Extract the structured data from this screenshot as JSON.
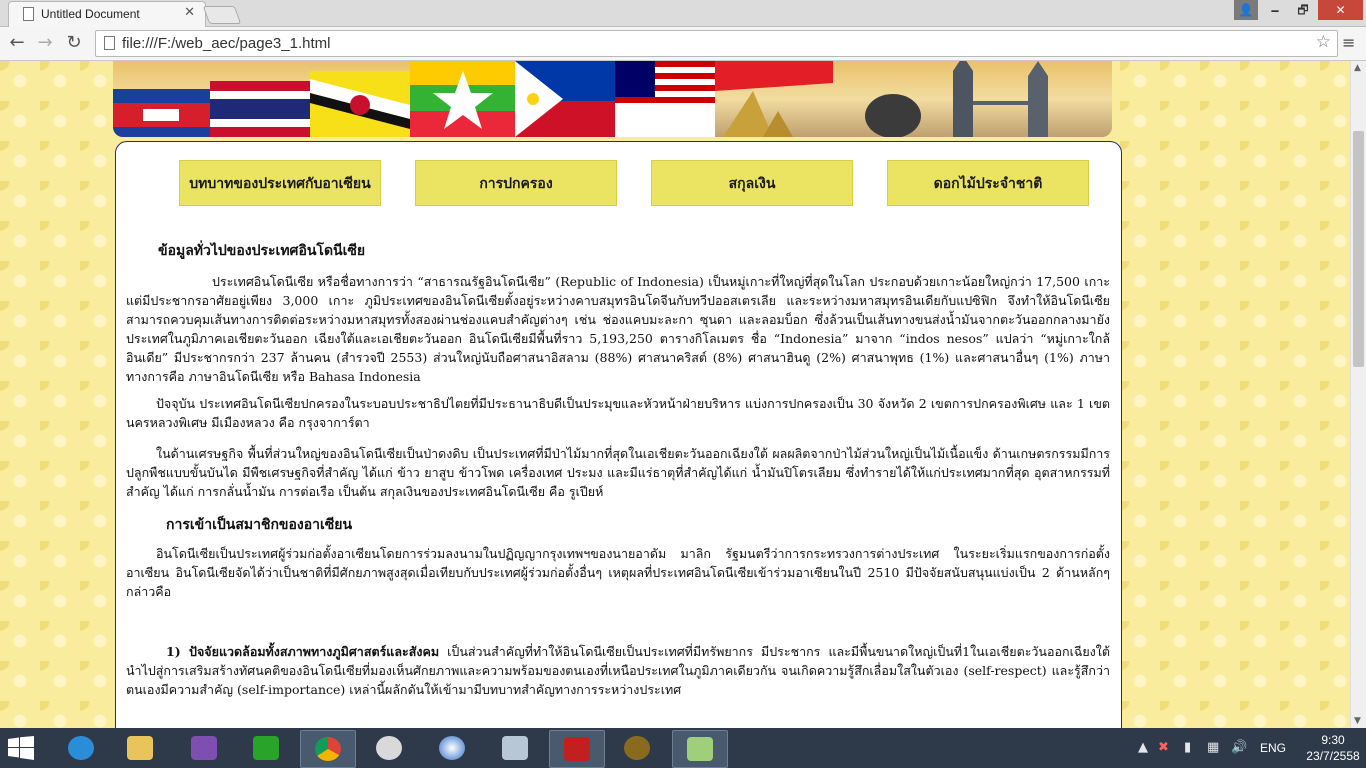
{
  "tab": {
    "title": "Untitled Document",
    "close": "✕"
  },
  "window": {
    "minimize": "🗕",
    "maximize": "🗗",
    "close": "✕",
    "user": "👤"
  },
  "toolbar": {
    "back": "←",
    "forward": "→",
    "reload": "↻",
    "star": "☆",
    "menu": "≡"
  },
  "address": {
    "url": "file:///F:/web_aec/page3_1.html"
  },
  "nav": {
    "buttons": [
      "บทบาทของประเทศกับอาเซียน",
      "การปกครอง",
      "สกุลเงิน",
      "ดอกไม้ประจำชาติ"
    ]
  },
  "content": {
    "heading1": "ข้อมูลทั่วไปของประเทศอินโดนีเซีย",
    "para1": "ประเทศอินโดนีเซีย หรือชื่อทางการว่า “สาธารณรัฐอินโดนีเซีย” (Republic of Indonesia) เป็นหมู่เกาะที่ใหญ่ที่สุดในโลก ประกอบด้วยเกาะน้อยใหญ่กว่า 17,500 เกาะ แต่มีประชากรอาศัยอยู่เพียง 3,000 เกาะ ภูมิประเทศของอินโดนีเซียตั้งอยู่ระหว่างคาบสมุทรอินโดจีนกับทวีปออสเตรเลีย และระหว่างมหาสมุทรอินเดียกับแปซิฟิก จึงทำให้อินโดนีเซียสามารถควบคุมเส้นทางการติดต่อระหว่างมหาสมุทรทั้งสองผ่านช่องแคบสำคัญต่างๆ เช่น ช่องแคบมะละกา ซุนดา และลอมบ็อก ซึ่งล้วนเป็นเส้นทางขนส่งน้ำมันจากตะวันออกกลางมายังประเทศในภูมิภาคเอเชียตะวันออก เฉียงใต้และเอเชียตะวันออก อินโดนีเซียมีพื้นที่ราว 5,193,250 ตารางกิโลเมตร ชื่อ “Indonesia” มาจาก “indos nesos” แปลว่า “หมู่เกาะใกล้อินเดีย” มีประชากรกว่า 237 ล้านคน (สำรวจปี 2553) ส่วนใหญ่นับถือศาสนาอิสลาม (88%) ศาสนาคริสต์ (8%) ศาสนาฮินดู (2%) ศาสนาพุทธ (1%) และศาสนาอื่นๆ (1%) ภาษาทางการคือ ภาษาอินโดนีเซีย หรือ Bahasa Indonesia",
    "para2": "ปัจจุบัน ประเทศอินโดนีเซียปกครองในระบอบประชาธิปไตยที่มีประธานาธิบดีเป็นประมุขและหัวหน้าฝ่ายบริหาร แบ่งการปกครองเป็น 30 จังหวัด 2 เขตการปกครองพิเศษ และ 1 เขตนครหลวงพิเศษ มีเมืองหลวง คือ กรุงจาการ์ตา",
    "para3": "ในด้านเศรษฐกิจ พื้นที่ส่วนใหญ่ของอินโดนีเซียเป็นป่าดงดิบ เป็นประเทศที่มีป่าไม้มากที่สุดในเอเชียตะวันออกเฉียงใต้ ผลผลิตจากป่าไม้ส่วนใหญ่เป็นไม้เนื้อแข็ง ด้านเกษตรกรรมมีการปลูกพืชแบบขั้นบันได มีพืชเศรษฐกิจที่สำคัญ ได้แก่ ข้าว ยาสูบ ข้าวโพด เครื่องเทศ ประมง และมีแร่ธาตุที่สำคัญได้แก่ น้ำมันปิโตรเลียม ซึ่งทำรายได้ให้แก่ประเทศมากที่สุด อุตสาหกรรมที่สำคัญ ได้แก่ การกลั่นน้ำมัน การต่อเรือ เป็นต้น สกุลเงินของประเทศอินโดนีเซีย คือ รูเปียห์",
    "heading2": "การเข้าเป็นสมาชิกของอาเซียน",
    "para4": "อินโดนีเซียเป็นประเทศผู้ร่วมก่อตั้งอาเซียนโดยการร่วมลงนามในปฏิญญากรุงเทพฯของนายอาดัม มาลิก รัฐมนตรีว่าการกระทรวงการต่างประเทศ ในระยะเริ่มแรกของการก่อตั้งอาเซียน อินโดนีเซียจัดได้ว่าเป็นชาติที่มีศักยภาพสูงสุดเมื่อเทียบกับประเทศผู้ร่วมก่อตั้งอื่นๆ เหตุผลที่ประเทศอินโดนีเซียเข้าร่วมอาเซียนในปี 2510 มีปัจจัยสนับสนุนแบ่งเป็น 2 ด้านหลักๆ กล่าวคือ",
    "para5_lead": "1) ปัจจัยแวดล้อมทั้งสภาพทางภูมิศาสตร์และสังคม",
    "para5_rest": " เป็นส่วนสำคัญที่ทำให้อินโดนีเซียเป็นประเทศที่มีทรัพยากร มีประชากร และมีพื้นขนาดใหญ่เป็นที่1ในเอเชียตะวันออกเฉียงใต้ นำไปสู่การเสริมสร้างทัศนคติของอินโดนีเซียที่มองเห็นศักยภาพและความพร้อมของตนเองที่เหนือประเทศในภูมิภาคเดียวกัน จนเกิดความรู้สึกเลื่อมใสในตัวเอง (self-respect) และรู้สึกว่าตนเองมีความสำคัญ (self-importance) เหล่านี้ผลักดันให้เข้ามามีบทบาทสำคัญทางการระหว่างประเทศ"
  },
  "taskbar": {
    "items": [
      "internet-explorer-icon",
      "file-explorer-icon",
      "visual-studio-icon",
      "store-icon",
      "chrome-icon",
      "compass-icon",
      "orb-icon",
      "monitor-icon",
      "red-app-icon",
      "hon-icon",
      "drive-icon"
    ],
    "language": "ENG",
    "time": "9:30",
    "date": "23/7/2558"
  }
}
